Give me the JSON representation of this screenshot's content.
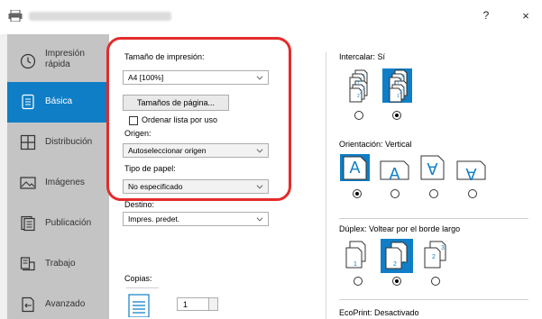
{
  "window": {
    "help_label": "?",
    "close_label": "×"
  },
  "nav": {
    "items": [
      {
        "label": "Impresión\nrápida",
        "icon": "clock-icon"
      },
      {
        "label": "Básica",
        "icon": "document-icon",
        "active": true
      },
      {
        "label": "Distribución",
        "icon": "grid-layout-icon"
      },
      {
        "label": "Imágenes",
        "icon": "image-icon"
      },
      {
        "label": "Publicación",
        "icon": "booklet-icon"
      },
      {
        "label": "Trabajo",
        "icon": "job-icon"
      },
      {
        "label": "Avanzado",
        "icon": "advanced-icon"
      }
    ],
    "active_color": "#0f7ec6"
  },
  "basic": {
    "print_size_label": "Tamaño de impresión:",
    "print_size_value": "A4  [100%]",
    "page_sizes_button": "Tamaños de página...",
    "sort_list_label": "Ordenar lista por uso",
    "sort_list_checked": false,
    "source_label": "Origen:",
    "source_value": "Autoseleccionar origen",
    "paper_type_label": "Tipo de papel:",
    "paper_type_value": "No especificado",
    "destination_label": "Destino:",
    "destination_value": "Impres. predet.",
    "copies_label": "Copias:",
    "copies_value": "1",
    "highlight_color": "#e42b2b"
  },
  "collate": {
    "label": "Intercalar:  Sí",
    "selected_index": 1
  },
  "orientation": {
    "label": "Orientación:  Vertical",
    "selected_index": 0,
    "glyph": "A"
  },
  "duplex": {
    "label": "Dúplex:  Voltear por el borde largo",
    "selected_index": 1
  },
  "ecoprint": {
    "label": "EcoPrint:  Desactivado"
  }
}
